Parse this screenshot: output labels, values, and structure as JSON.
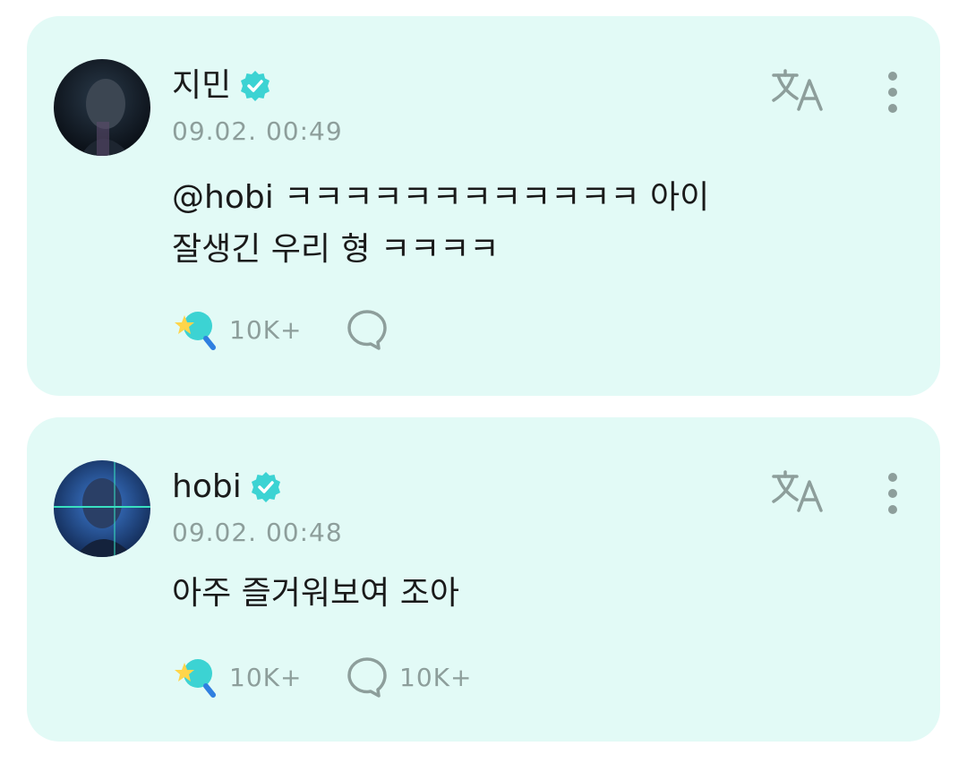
{
  "posts": [
    {
      "author": "지민",
      "verified": true,
      "timestamp": "09.02. 00:49",
      "text": "@hobi ㅋㅋㅋㅋㅋㅋㅋㅋㅋㅋㅋㅋ 아이\n잘생긴 우리 형 ㅋㅋㅋㅋ",
      "likes": "10K+",
      "comments": ""
    },
    {
      "author": "hobi",
      "verified": true,
      "timestamp": "09.02. 00:48",
      "text": "아주 즐거워보여 조아",
      "likes": "10K+",
      "comments": "10K+"
    }
  ],
  "icons": {
    "verified": "verified-badge-icon",
    "translate": "translate-icon",
    "more": "more-vertical-icon",
    "like": "star-bubble-icon",
    "comment": "comment-bubble-icon"
  },
  "colors": {
    "card_background": "#e2faf6",
    "accent": "#3cd3d3",
    "muted_text": "#8d9e9b"
  }
}
